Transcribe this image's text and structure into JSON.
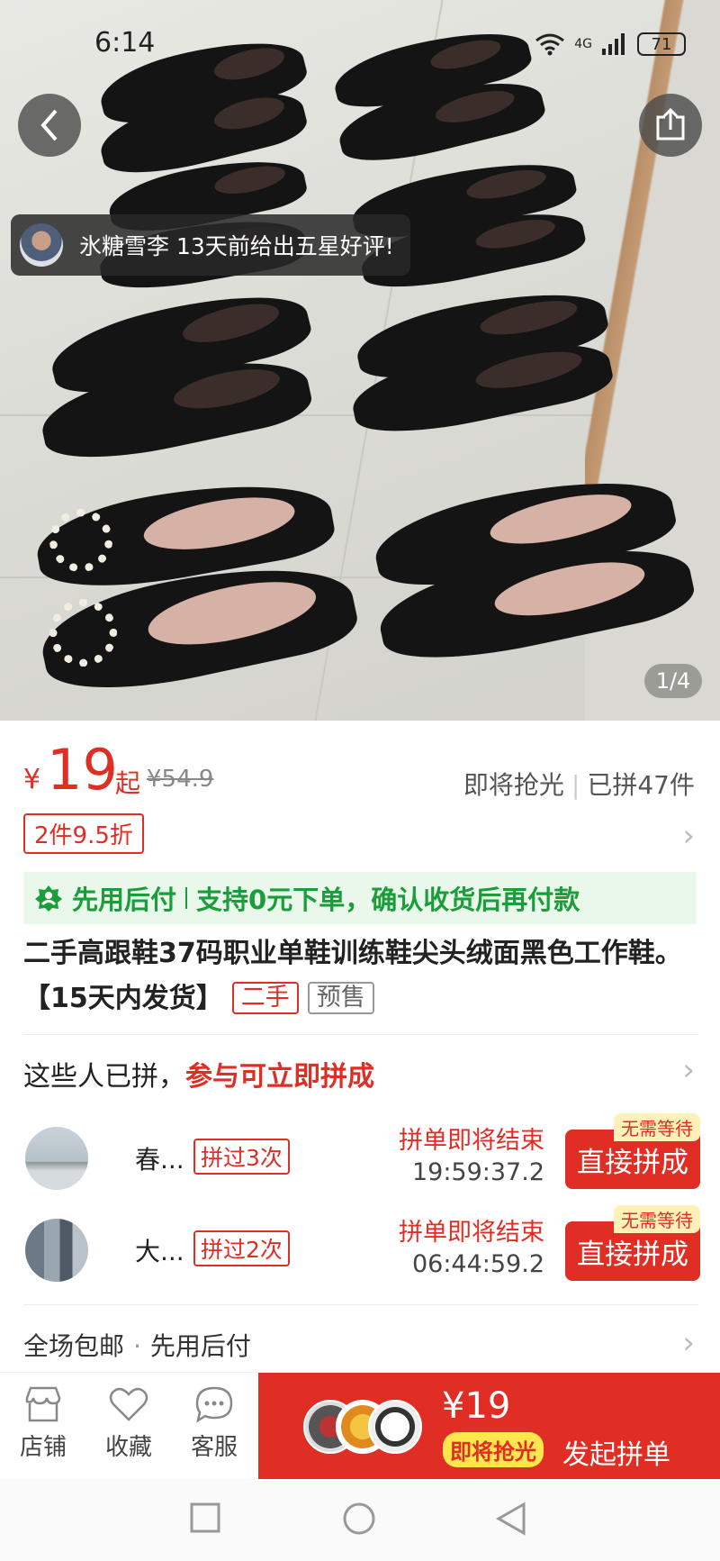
{
  "status_bar": {
    "time": "6:14",
    "network": "4G",
    "battery": "71"
  },
  "gallery": {
    "toast_user": "氷糖雪李",
    "toast_text": "氷糖雪李 13天前给出五星好评!",
    "page_indicator": "1/4"
  },
  "price": {
    "currency": "¥",
    "amount": "19",
    "from_label": "起",
    "original": "¥54.9",
    "selling_fast": "即将抢光",
    "sold": "已拼47件",
    "discount": "2件9.5折"
  },
  "pay_later": {
    "label": "先用后付",
    "detail": "支持0元下单，确认收货后再付款"
  },
  "product": {
    "title": "二手高跟鞋37码职业单鞋训练鞋尖头绒面黑色工作鞋。【15天内发货】",
    "tag_secondhand": "二手",
    "tag_presale": "预售"
  },
  "group": {
    "heading": "这些人已拼，",
    "heading_highlight": "参与可立即拼成",
    "rows": [
      {
        "name": "春...",
        "count": "拼过3次",
        "ending": "拼单即将结束",
        "timer": "19:59:37.2",
        "badge": "无需等待",
        "button": "直接拼成"
      },
      {
        "name": "大...",
        "count": "拼过2次",
        "ending": "拼单即将结束",
        "timer": "06:44:59.2",
        "badge": "无需等待",
        "button": "直接拼成"
      }
    ]
  },
  "shipping": {
    "free": "全场包邮",
    "dot": "·",
    "pay": "先用后付"
  },
  "bottom_bar": {
    "store": "店铺",
    "favorite": "收藏",
    "service": "客服",
    "buy_price": "¥19",
    "buy_hot": "即将抢光",
    "buy_label": "发起拼单"
  },
  "colors": {
    "accent": "#e02e24",
    "green": "#1a9d3a"
  }
}
